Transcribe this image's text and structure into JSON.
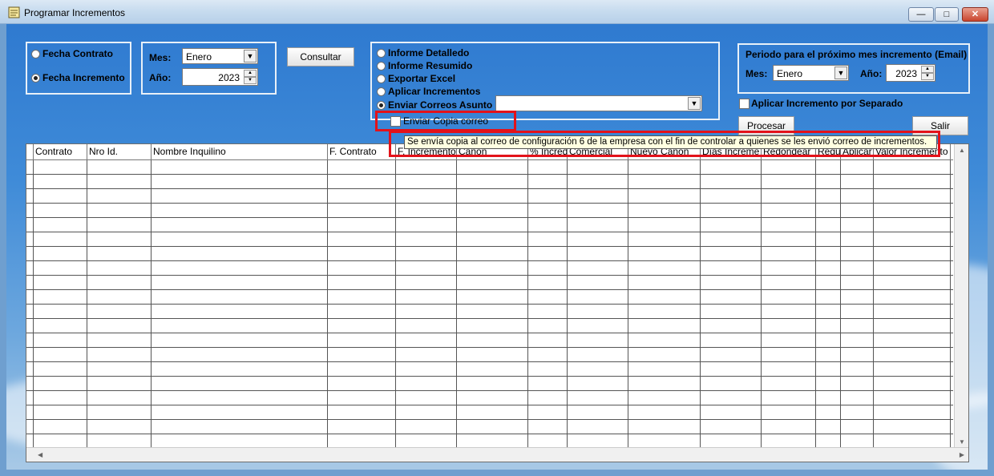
{
  "window": {
    "title": "Programar Incrementos"
  },
  "filter_type": {
    "options": [
      "Fecha Contrato",
      "Fecha Incremento"
    ],
    "selected": "Fecha Incremento"
  },
  "period": {
    "month_label": "Mes:",
    "month_value": "Enero",
    "year_label": "Año:",
    "year_value": "2023"
  },
  "consultar_label": "Consultar",
  "report_options": {
    "items": [
      "Informe Detalledo",
      "Informe Resumido",
      "Exportar Excel",
      "Aplicar Incrementos",
      "Enviar Correos Asunto"
    ],
    "selected": "Enviar Correos Asunto",
    "asunto_value": "",
    "copy_checkbox_label": "Enviar Copia correo"
  },
  "next_increment": {
    "title": "Periodo para el próximo mes incremento (Email)",
    "month_label": "Mes:",
    "month_value": "Enero",
    "year_label": "Año:",
    "year_value": "2023"
  },
  "apply_separate_label": "Aplicar Incremento por Separado",
  "procesar_label": "Procesar",
  "salir_label": "Salir",
  "tooltip": "Se envía copia al correo de configuración 6 de la empresa con el fin de controlar a quienes se les envió correo de incrementos.",
  "grid": {
    "columns": [
      "Contrato",
      "Nro Id.",
      "Nombre Inquilino",
      "F. Contrato",
      "F. Incremento",
      "Canon",
      "% Incred",
      "Comercial",
      "Nuevo Canon",
      "Días Increme",
      "Redondear",
      "Regu",
      "Aplicar",
      "Valor Incremento"
    ],
    "row_count": 20
  }
}
